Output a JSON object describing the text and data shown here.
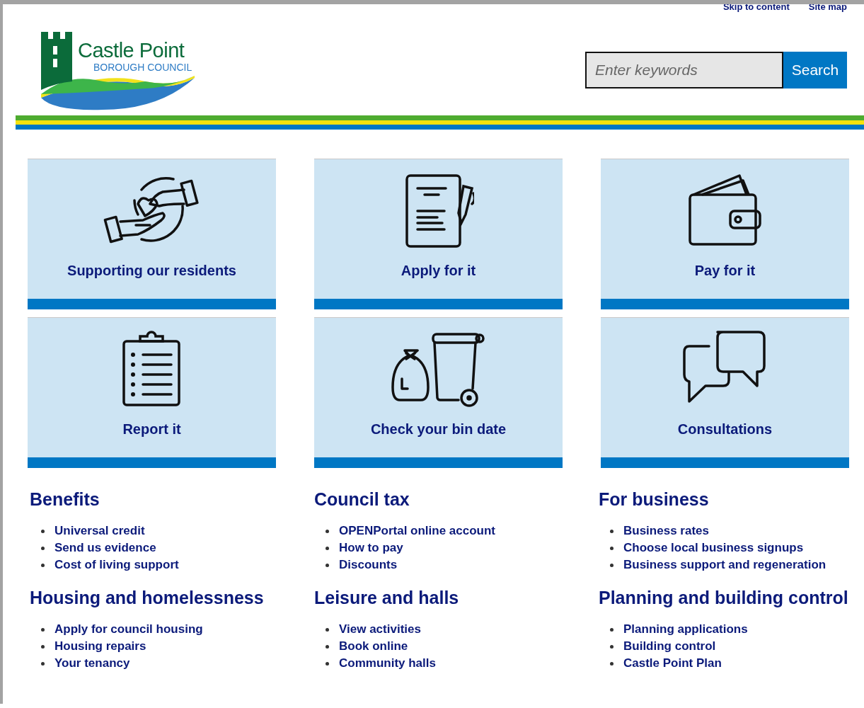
{
  "top_links": [
    "Skip to content",
    "Site map"
  ],
  "logo": {
    "name": "Castle Point",
    "subtitle": "BOROUGH COUNCIL"
  },
  "search": {
    "placeholder": "Enter keywords",
    "button": "Search"
  },
  "tiles": [
    {
      "label": "Supporting our residents",
      "kind": "hands"
    },
    {
      "label": "Apply for it",
      "kind": "form"
    },
    {
      "label": "Pay for it",
      "kind": "wallet"
    },
    {
      "label": "Report it",
      "kind": "clipboard"
    },
    {
      "label": "Check your bin date",
      "kind": "bin"
    },
    {
      "label": "Consultations",
      "kind": "chat"
    }
  ],
  "sections": [
    {
      "title": "Benefits",
      "links": [
        "Universal credit",
        "Send us evidence",
        "Cost of living support"
      ]
    },
    {
      "title": "Council tax",
      "links": [
        "OPENPortal online account",
        "How to pay",
        "Discounts"
      ]
    },
    {
      "title": "For business",
      "links": [
        "Business rates",
        "Choose local business signups",
        "Business support and regeneration"
      ]
    },
    {
      "title": "Housing and homelessness",
      "links": [
        "Apply for council housing",
        "Housing repairs",
        "Your tenancy"
      ]
    },
    {
      "title": "Leisure and halls",
      "links": [
        "View activities",
        "Book online",
        "Community halls"
      ]
    },
    {
      "title": "Planning and building control",
      "links": [
        "Planning applications",
        "Building control",
        "Castle Point Plan"
      ]
    }
  ]
}
